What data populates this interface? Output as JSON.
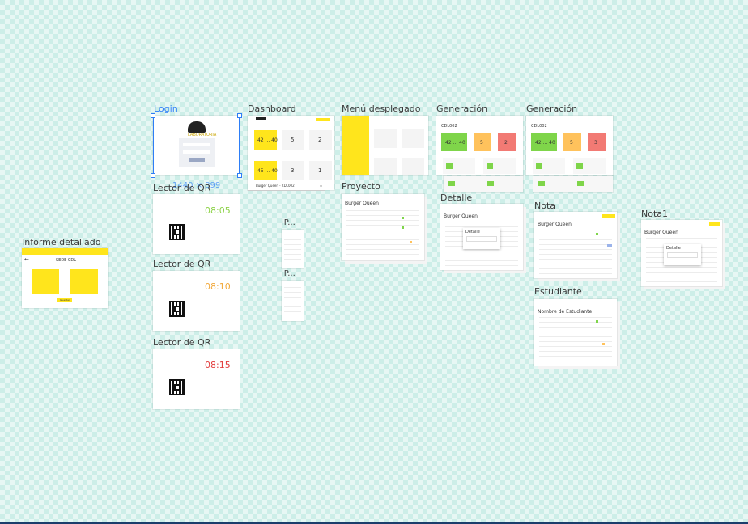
{
  "frames": {
    "login": {
      "label": "Login",
      "size_tag": "1440 × 899",
      "logo_text": "LABORATORIA"
    },
    "dashboard": {
      "label": "Dashboard",
      "dropdown": "Burger Queen - CDL002",
      "num_left": "42 ... 40",
      "num_left2": "45 ... 40",
      "stat_a": "5",
      "stat_b": "2",
      "stat_c": "3",
      "stat_d": "1"
    },
    "menu": {
      "label": "Menú desplegado"
    },
    "generacion1": {
      "label": "Generación",
      "code": "CDL002",
      "big": "42 ... 40",
      "s1": "5",
      "s2": "2"
    },
    "generacion2": {
      "label": "Generación",
      "code": "CDL002",
      "big": "42 ... 40",
      "s1": "5",
      "s2": "3"
    },
    "qr1": {
      "label": "Lector de QR",
      "time": "08:05",
      "time_color": "#8ed34a"
    },
    "qr2": {
      "label": "Lector de QR",
      "time": "08:10",
      "time_color": "#f2a93b"
    },
    "qr3": {
      "label": "Lector de QR",
      "time": "08:15",
      "time_color": "#e23c3c"
    },
    "iphone1": {
      "label": "iP..."
    },
    "iphone2": {
      "label": "iP..."
    },
    "proyecto": {
      "label": "Proyecto",
      "title": "Burger Queen"
    },
    "detalle": {
      "label": "Detalle",
      "title": "Burger Queen",
      "modal": "Detalle"
    },
    "nota": {
      "label": "Nota",
      "title": "Burger Queen"
    },
    "nota1": {
      "label": "Nota1",
      "title": "Burger Queen",
      "modal": "Detalle"
    },
    "estudiante": {
      "label": "Estudiante",
      "title": "Nombre de Estudiante"
    },
    "informe": {
      "label": "Informe detallado",
      "title": "SEDE CDL",
      "button": "Guardar"
    }
  }
}
